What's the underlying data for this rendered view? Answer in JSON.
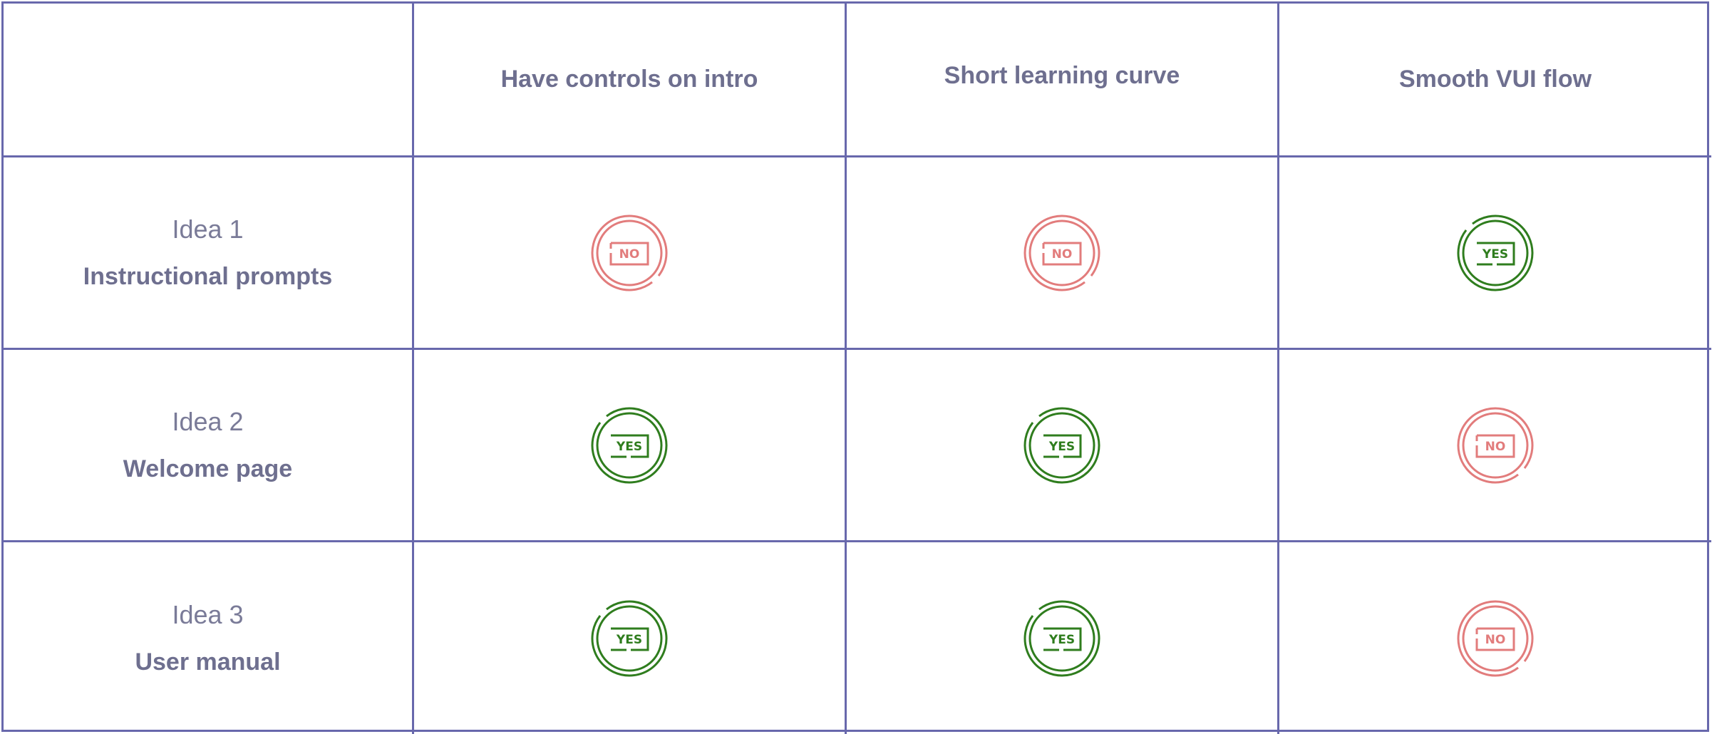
{
  "columns": [
    "Have controls on intro",
    "Short learning curve",
    "Smooth VUI flow"
  ],
  "rows": [
    {
      "idea": "Idea 1",
      "name": "Instructional prompts",
      "values": [
        "NO",
        "NO",
        "YES"
      ]
    },
    {
      "idea": "Idea 2",
      "name": "Welcome page",
      "values": [
        "YES",
        "YES",
        "NO"
      ]
    },
    {
      "idea": "Idea 3",
      "name": "User manual",
      "values": [
        "YES",
        "YES",
        "NO"
      ]
    }
  ],
  "colors": {
    "grid": "#6868ac",
    "yes": "#2f7d1e",
    "no": "#e27c7c",
    "header_text": "#6e6f8f"
  },
  "icons": {
    "yes": "yes-badge-icon",
    "no": "no-badge-icon"
  }
}
